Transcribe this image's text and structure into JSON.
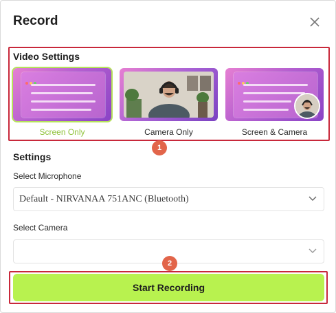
{
  "dialog": {
    "title": "Record"
  },
  "video_settings": {
    "title": "Video Settings",
    "options": [
      {
        "label": "Screen Only",
        "selected": true
      },
      {
        "label": "Camera Only",
        "selected": false
      },
      {
        "label": "Screen & Camera",
        "selected": false
      }
    ]
  },
  "settings": {
    "title": "Settings",
    "microphone": {
      "label": "Select Microphone",
      "value": "Default - NIRVANAA 751ANC (Bluetooth)"
    },
    "camera": {
      "label": "Select Camera",
      "value": ""
    }
  },
  "action": {
    "start_label": "Start Recording"
  },
  "annotations": {
    "badge1": "1",
    "badge2": "2"
  },
  "colors": {
    "accent": "#b8f24f",
    "selected_text": "#8fc23a",
    "highlight": "#c8283a",
    "badge": "#e2654a"
  },
  "icons": {
    "close": "close-icon",
    "chevron": "chevron-down-icon"
  }
}
